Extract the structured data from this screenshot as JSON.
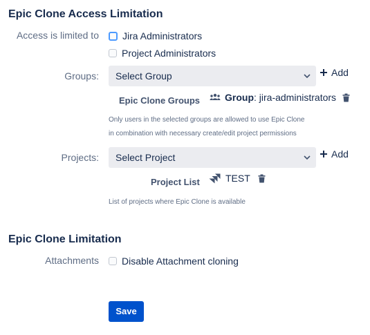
{
  "section1": {
    "title": "Epic Clone Access Limitation",
    "access_label": "Access is limited to",
    "options": [
      "Jira Administrators",
      "Project Administrators"
    ],
    "groups_label": "Groups:",
    "groups_select": "Select Group",
    "add_label": "Add",
    "groups_list_title": "Epic Clone Groups",
    "group_prefix": "Group",
    "group_sep": ":",
    "group_value": "jira-administrators",
    "groups_help_line1": "Only users in the selected groups are allowed to use Epic Clone",
    "groups_help_line2": "in combination with necessary create/edit project permissions",
    "projects_label": "Projects:",
    "projects_select": "Select Project",
    "project_list_title": "Project List",
    "project_value": "TEST",
    "projects_help": "List of projects where Epic Clone is available"
  },
  "section2": {
    "title": "Epic Clone Limitation",
    "attachments_label": "Attachments",
    "attachments_option": "Disable Attachment cloning"
  },
  "save_label": "Save",
  "colors": {
    "primary": "#0052cc",
    "focus": "#4c9aff",
    "select_bg": "#ebecf0"
  },
  "icons": [
    "plus-icon",
    "chevron-down-icon",
    "users-icon",
    "trash-icon",
    "jira-icon"
  ]
}
